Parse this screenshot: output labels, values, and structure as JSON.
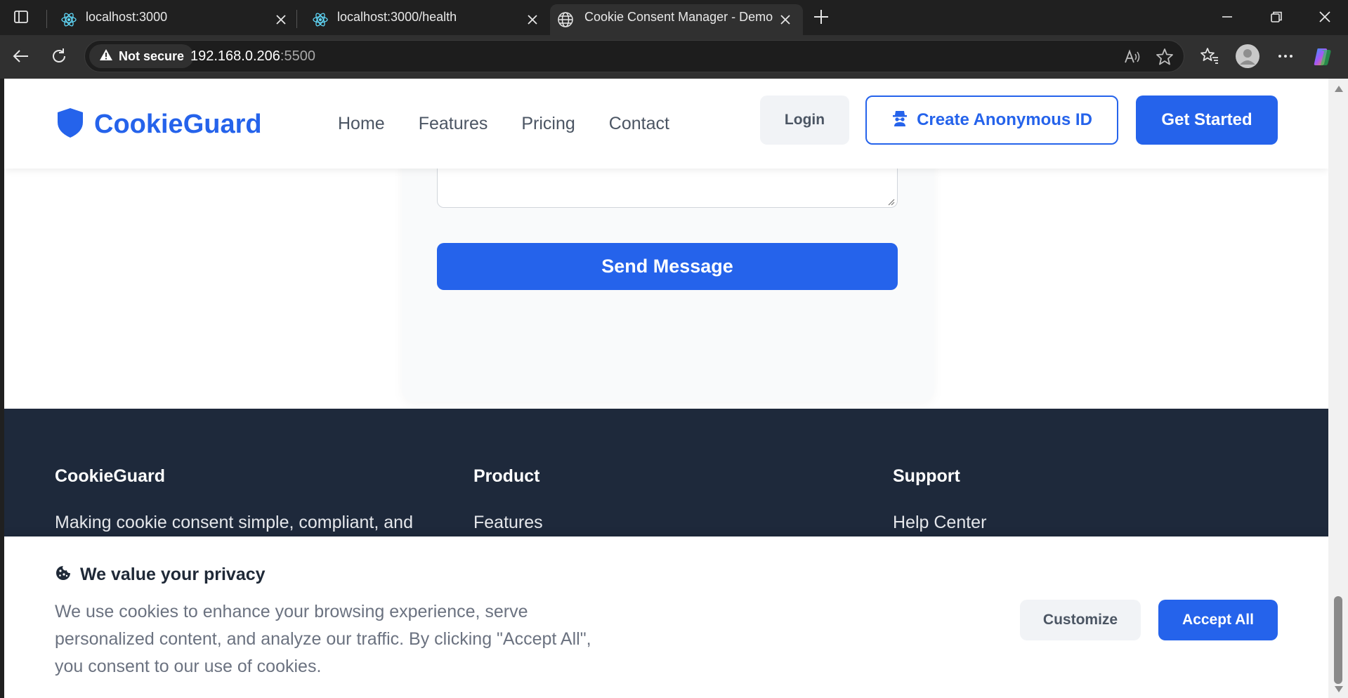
{
  "browser": {
    "tabs": [
      {
        "title": "localhost:3000",
        "icon": "react-icon",
        "active": false
      },
      {
        "title": "localhost:3000/health",
        "icon": "react-icon",
        "active": false
      },
      {
        "title": "Cookie Consent Manager - Demo",
        "icon": "globe-icon",
        "active": true
      }
    ],
    "address": {
      "security_label": "Not secure",
      "host": "192.168.0.206",
      "port": ":5500"
    }
  },
  "site_nav": {
    "brand": "CookieGuard",
    "links": [
      "Home",
      "Features",
      "Pricing",
      "Contact"
    ],
    "login_label": "Login",
    "anon_label": "Create Anonymous ID",
    "get_started_label": "Get Started"
  },
  "contact": {
    "send_label": "Send Message"
  },
  "footer": {
    "col1": {
      "title": "CookieGuard",
      "text": "Making cookie consent simple, compliant, and"
    },
    "col2": {
      "title": "Product",
      "link": "Features"
    },
    "col3": {
      "title": "Support",
      "link": "Help Center"
    }
  },
  "cookie_banner": {
    "title": "We value your privacy",
    "text": "We use cookies to enhance your browsing experience, serve personalized content, and analyze our traffic. By clicking \"Accept All\", you consent to our use of cookies.",
    "customize_label": "Customize",
    "accept_label": "Accept All"
  },
  "colors": {
    "brand": "#2563eb",
    "footer_bg": "#1e293b",
    "muted_text": "#6b7280"
  }
}
